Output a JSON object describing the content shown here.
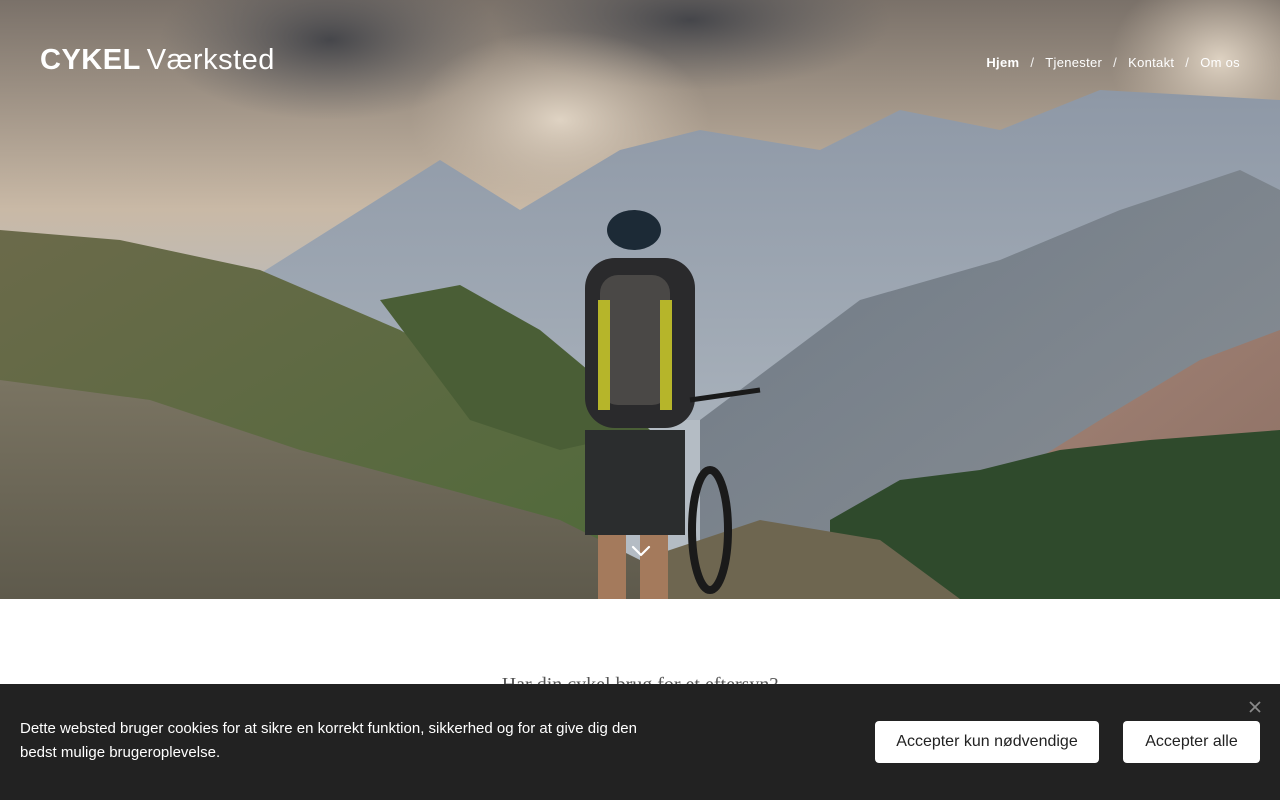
{
  "logo": {
    "strong": "CYKEL",
    "light": "Værksted"
  },
  "nav": {
    "items": [
      "Hjem",
      "Tjenester",
      "Kontakt",
      "Om os"
    ],
    "separator": "/"
  },
  "hero": {
    "scroll_icon": "chevron-down-icon"
  },
  "content": {
    "headline": "Har din cykel brug for et eftersyn?"
  },
  "cookie": {
    "text": "Dette websted bruger cookies for at sikre en korrekt funktion, sikkerhed og for at give dig den bedst mulige brugeroplevelse.",
    "necessary_label": "Accepter kun nødvendige",
    "all_label": "Accepter alle",
    "close_icon": "close-icon"
  },
  "colors": {
    "cookie_bg": "#222222",
    "button_bg": "#ffffff",
    "nav_text": "#ffffff"
  }
}
